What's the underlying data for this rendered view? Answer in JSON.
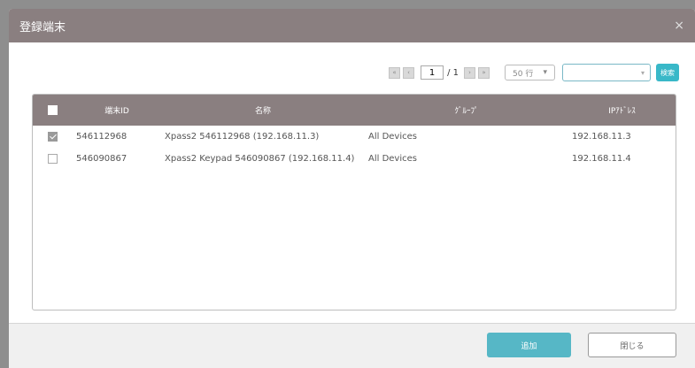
{
  "dialog": {
    "title": "登録端末",
    "close_label": "×"
  },
  "pagination": {
    "first": "«",
    "prev": "‹",
    "page": "1",
    "separator": "/",
    "total": "1",
    "next": "›",
    "last": "»",
    "rows_per_page": "50 行",
    "rows_arrow": "▾",
    "search_arrow": "▾",
    "search_label": "検索"
  },
  "table": {
    "headers": {
      "id": "端末ID",
      "name": "名称",
      "group": "ｸﾞﾙｰﾌﾟ",
      "ip": "IPｱﾄﾞﾚｽ"
    },
    "rows": [
      {
        "id": "546112968",
        "name": "Xpass2 546112968 (192.168.11.3)",
        "group": "All Devices",
        "ip": "192.168.11.3",
        "checked": true
      },
      {
        "id": "546090867",
        "name": "Xpass2 Keypad 546090867 (192.168.11.4)",
        "group": "All Devices",
        "ip": "192.168.11.4",
        "checked": false
      }
    ]
  },
  "footer": {
    "add_label": "追加",
    "close_label": "閉じる"
  },
  "colors": {
    "header": "#8a7f80",
    "accent": "#56b7c6"
  }
}
